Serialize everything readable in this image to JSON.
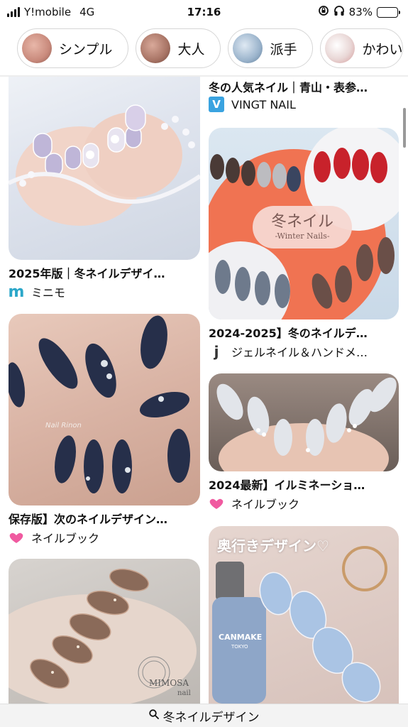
{
  "status_bar": {
    "carrier": "Y!mobile",
    "network": "4G",
    "time": "17:16",
    "battery": "83%",
    "battery_level": 0.83
  },
  "chips": [
    {
      "label": "シンプル",
      "thumb_color": "#c98a7c"
    },
    {
      "label": "大人",
      "thumb_color": "#a87465"
    },
    {
      "label": "派手",
      "thumb_color": "#9bb4cc"
    },
    {
      "label": "かわい",
      "thumb_color": "#e9d7d6"
    }
  ],
  "pins": {
    "top_right": {
      "title": "冬の人気ネイル｜青山・表参…",
      "source": "VINGT NAIL",
      "source_icon": "V",
      "source_color": "#3aa3e0"
    },
    "winter_pastel": {
      "title": "2025年版｜冬ネイルデザイ…",
      "source": "ミニモ",
      "source_icon": "m",
      "source_color": "#2ba7c9"
    },
    "winter_nails_poster": {
      "title": "2024-2025】冬のネイルデ…",
      "source": "ジェルネイル＆ハンドメ…",
      "source_icon": "j",
      "source_color": "#333333",
      "badge_title": "冬ネイル",
      "badge_sub": "-Winter Nails-"
    },
    "navy_nails": {
      "title": "保存版】次のネイルデザイン…",
      "source": "ネイルブック",
      "source_icon": "heart",
      "source_color": "#f05aa0",
      "watermark": "Nail Rinon"
    },
    "silver_nails": {
      "title": "2024最新】イルミネーショ…",
      "source": "ネイルブック",
      "source_icon": "heart",
      "source_color": "#f05aa0"
    },
    "brown_nails": {
      "watermark": "MIMOSA",
      "watermark_sub": "nail"
    },
    "blue_canmake": {
      "caption": "奥行きデザイン♡",
      "bottle_brand": "CANMAKE",
      "bottle_sub": "TOKYO"
    }
  },
  "search": {
    "query": "冬ネイルデザイン"
  }
}
